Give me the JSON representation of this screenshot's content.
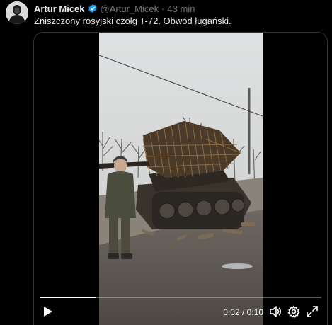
{
  "tweet": {
    "author_name": "Artur Micek",
    "handle": "@Artur_Micek",
    "separator": "·",
    "time": "43 min",
    "text": "Zniszczony rosyjski czołg T-72. Obwód ługański."
  },
  "video": {
    "current_time": "0:02",
    "time_divider": " / ",
    "duration": "0:10",
    "progress": 0.2
  },
  "icons": {
    "verified": "verified-badge-icon",
    "play": "play-icon",
    "volume": "volume-icon",
    "settings": "gear-icon",
    "fullscreen": "fullscreen-icon"
  },
  "colors": {
    "background": "#000000",
    "text": "#e7e9ea",
    "secondary_text": "#71767b",
    "verified_blue": "#1d9bf0",
    "border": "#2f3336"
  }
}
